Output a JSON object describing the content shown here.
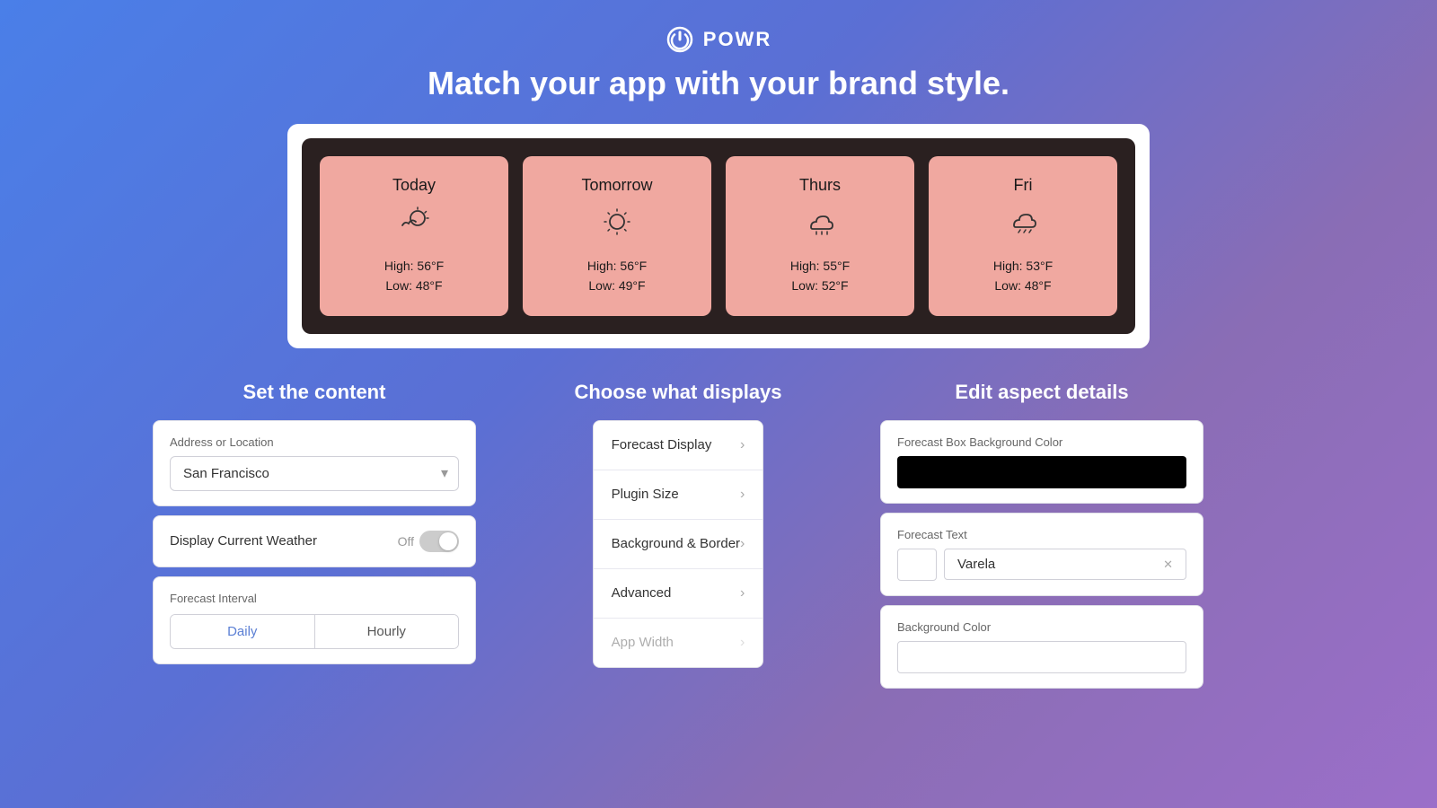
{
  "brand": {
    "name": "POWR",
    "icon": "power-icon"
  },
  "tagline": "Match your app with your brand style.",
  "weather_preview": {
    "cards": [
      {
        "day": "Today",
        "icon": "☀️🌤",
        "high": "High: 56°F",
        "low": "Low: 48°F"
      },
      {
        "day": "Tomorrow",
        "icon": "☀️",
        "high": "High: 56°F",
        "low": "Low: 49°F"
      },
      {
        "day": "Thurs",
        "icon": "🌧",
        "high": "High: 55°F",
        "low": "Low: 52°F"
      },
      {
        "day": "Fri",
        "icon": "🌨",
        "high": "High: 53°F",
        "low": "Low: 48°F"
      }
    ]
  },
  "panels": {
    "left": {
      "title": "Set the content",
      "address_label": "Address or Location",
      "address_value": "San Francisco",
      "display_current_label": "Display Current Weather",
      "toggle_state": "Off",
      "interval_label": "Forecast Interval",
      "interval_options": [
        "Daily",
        "Hourly"
      ],
      "interval_active": "Daily"
    },
    "middle": {
      "title": "Choose what displays",
      "items": [
        "Forecast Display",
        "Plugin Size",
        "Background & Border",
        "Advanced",
        "App Width"
      ]
    },
    "right": {
      "title": "Edit aspect details",
      "forecast_bg_label": "Forecast Box Background Color",
      "forecast_text_label": "Forecast Text",
      "font_name": "Varela",
      "bg_color_label": "Background Color"
    }
  }
}
